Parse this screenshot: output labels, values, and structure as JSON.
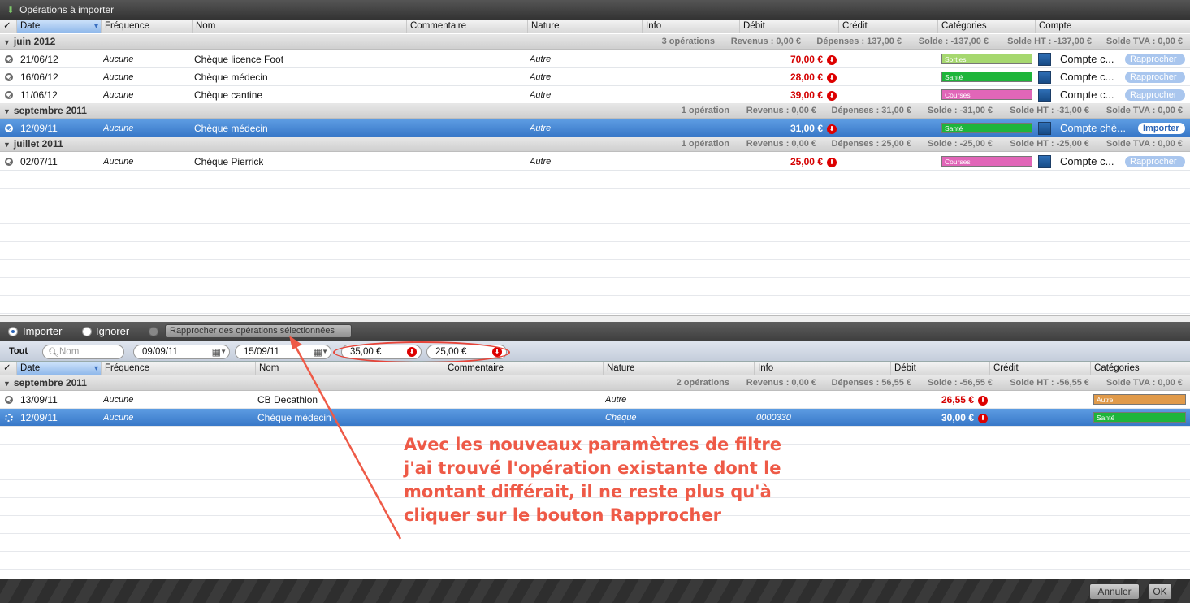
{
  "window": {
    "title": "Opérations à importer"
  },
  "top": {
    "columns": [
      "✓",
      "Date",
      "Fréquence",
      "Nom",
      "Commentaire",
      "Nature",
      "Info",
      "Débit",
      "Crédit",
      "Catégories",
      "Compte"
    ],
    "groups": [
      {
        "name": "juin 2012",
        "stats": {
          "count": "3 opérations",
          "revenus": "Revenus : 0,00 €",
          "depenses": "Dépenses : 137,00 €",
          "solde": "Solde : -137,00 €",
          "solde_ht": "Solde HT : -137,00 €",
          "solde_tva": "Solde TVA : 0,00 €"
        },
        "rows": [
          {
            "date": "21/06/12",
            "freq": "Aucune",
            "name": "Chèque licence Foot",
            "nature": "Autre",
            "info": "",
            "debit": "70,00 €",
            "category": "Sorties",
            "cat_color": "#a6d86f",
            "account": "Compte c...",
            "action": "Rapprocher",
            "selected": false
          },
          {
            "date": "16/06/12",
            "freq": "Aucune",
            "name": "Chèque médecin",
            "nature": "Autre",
            "info": "",
            "debit": "28,00 €",
            "category": "Santé",
            "cat_color": "#1eb53a",
            "account": "Compte c...",
            "action": "Rapprocher",
            "selected": false
          },
          {
            "date": "11/06/12",
            "freq": "Aucune",
            "name": "Chèque cantine",
            "nature": "Autre",
            "info": "",
            "debit": "39,00 €",
            "category": "Courses",
            "cat_color": "#e166b8",
            "account": "Compte c...",
            "action": "Rapprocher",
            "selected": false
          }
        ]
      },
      {
        "name": "septembre 2011",
        "stats": {
          "count": "1 opération",
          "revenus": "Revenus : 0,00 €",
          "depenses": "Dépenses : 31,00 €",
          "solde": "Solde : -31,00 €",
          "solde_ht": "Solde HT : -31,00 €",
          "solde_tva": "Solde TVA : 0,00 €"
        },
        "rows": [
          {
            "date": "12/09/11",
            "freq": "Aucune",
            "name": "Chèque médecin",
            "nature": "Autre",
            "info": "",
            "debit": "31,00 €",
            "category": "Santé",
            "cat_color": "#1eb53a",
            "account": "Compte chè...",
            "action": "Importer",
            "selected": true
          }
        ]
      },
      {
        "name": "juillet 2011",
        "stats": {
          "count": "1 opération",
          "revenus": "Revenus : 0,00 €",
          "depenses": "Dépenses : 25,00 €",
          "solde": "Solde : -25,00 €",
          "solde_ht": "Solde HT : -25,00 €",
          "solde_tva": "Solde TVA : 0,00 €"
        },
        "rows": [
          {
            "date": "02/07/11",
            "freq": "Aucune",
            "name": "Chèque Pierrick",
            "nature": "Autre",
            "info": "",
            "debit": "25,00 €",
            "category": "Courses",
            "cat_color": "#e166b8",
            "account": "Compte c...",
            "action": "Rapprocher",
            "selected": false
          }
        ]
      }
    ]
  },
  "actions": {
    "importer": "Importer",
    "ignorer": "Ignorer",
    "rapprocher_selected": "Rapprocher des opérations sélectionnées"
  },
  "filter": {
    "tout": "Tout",
    "search_placeholder": "Nom",
    "date_from": "09/09/11",
    "date_to": "15/09/11",
    "amount_min": "35,00 €",
    "amount_max": "25,00 €"
  },
  "bottom": {
    "columns": [
      "✓",
      "Date",
      "Fréquence",
      "Nom",
      "Commentaire",
      "Nature",
      "Info",
      "Débit",
      "Crédit",
      "Catégories"
    ],
    "group": {
      "name": "septembre 2011",
      "stats": {
        "count": "2 opérations",
        "revenus": "Revenus : 0,00 €",
        "depenses": "Dépenses : 56,55 €",
        "solde": "Solde : -56,55 €",
        "solde_ht": "Solde HT : -56,55 €",
        "solde_tva": "Solde TVA : 0,00 €"
      }
    },
    "rows": [
      {
        "date": "13/09/11",
        "freq": "Aucune",
        "name": "CB Decathlon",
        "nature": "Autre",
        "info": "",
        "debit": "26,55 €",
        "category": "Autre",
        "cat_color": "#e09a4a",
        "selected": false
      },
      {
        "date": "12/09/11",
        "freq": "Aucune",
        "name": "Chèque médecin",
        "nature": "Chèque",
        "info": "0000330",
        "debit": "30,00 €",
        "category": "Santé",
        "cat_color": "#1eb53a",
        "selected": true
      }
    ]
  },
  "annotation": "Avec les nouveaux paramètres de filtre j'ai trouvé l'opération existante dont le montant différait, il ne reste plus qu'à cliquer sur le bouton Rapprocher",
  "footer": {
    "cancel": "Annuler",
    "ok": "OK"
  }
}
